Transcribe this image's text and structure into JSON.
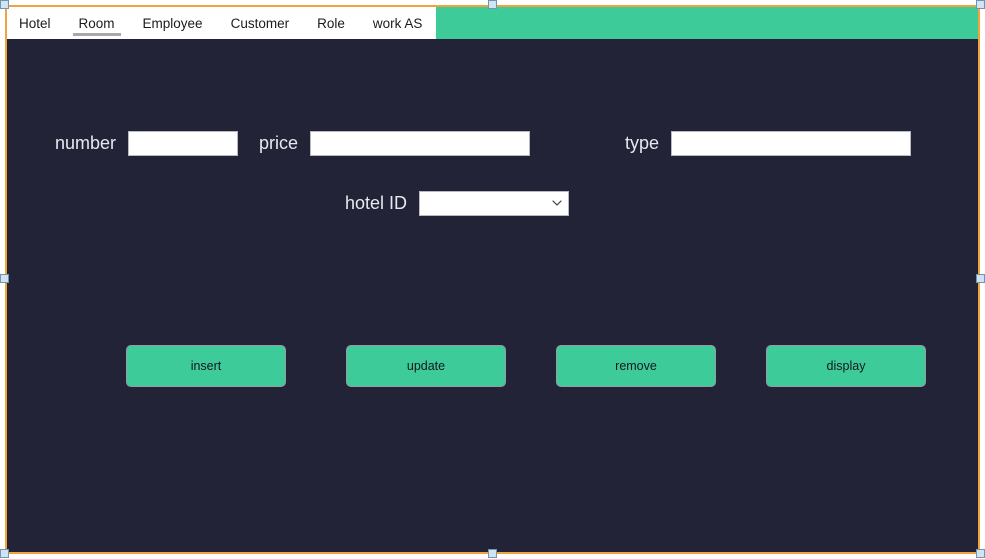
{
  "window": {
    "title": "Room",
    "border_color": "#f2a33c",
    "background_color": "#232338",
    "accent_color": "#3ccb99"
  },
  "tabs": {
    "active_index": 1,
    "items": [
      {
        "label": "Hotel"
      },
      {
        "label": "Room"
      },
      {
        "label": "Employee"
      },
      {
        "label": "Customer"
      },
      {
        "label": "Role"
      },
      {
        "label": "work AS"
      }
    ]
  },
  "form": {
    "fields": [
      {
        "label": "number",
        "value": "",
        "placeholder": ""
      },
      {
        "label": "price",
        "value": "",
        "placeholder": ""
      },
      {
        "label": "type",
        "value": "",
        "placeholder": ""
      }
    ],
    "hotel_id": {
      "label": "hotel ID",
      "value": "",
      "icon": "chevron-down-icon",
      "options": []
    }
  },
  "actions": {
    "buttons": [
      {
        "label": "insert"
      },
      {
        "label": "update"
      },
      {
        "label": "remove"
      },
      {
        "label": "display"
      }
    ]
  }
}
